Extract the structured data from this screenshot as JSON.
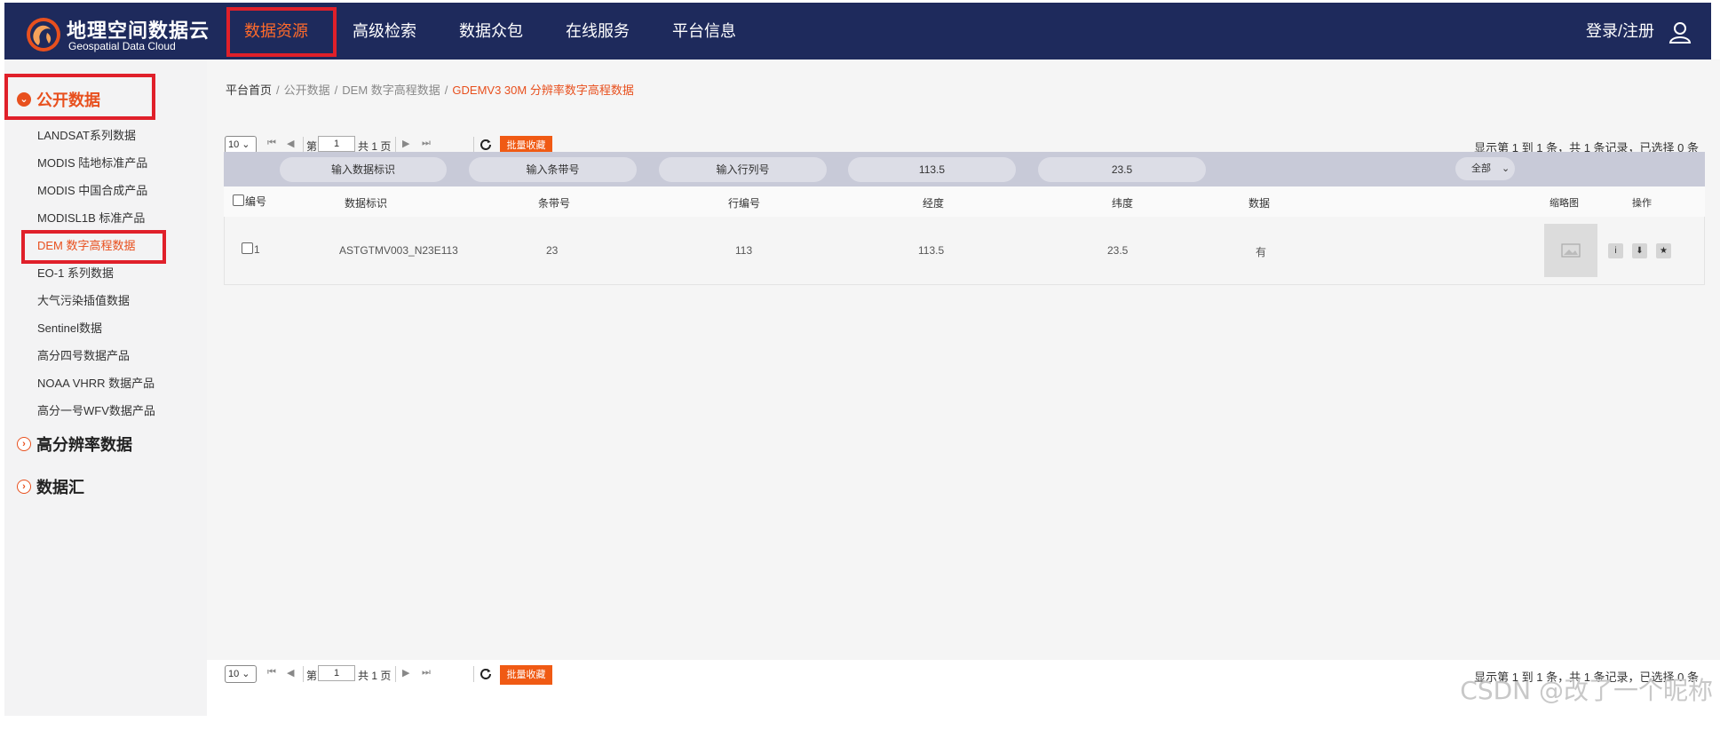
{
  "header": {
    "logo_title": "地理空间数据云",
    "logo_subtitle": "Geospatial Data Cloud",
    "nav": [
      {
        "label": "数据资源",
        "active": true
      },
      {
        "label": "高级检索"
      },
      {
        "label": "数据众包"
      },
      {
        "label": "在线服务"
      },
      {
        "label": "平台信息"
      }
    ],
    "login": "登录/注册",
    "bg_color": "#1e2a5c",
    "accent_color": "#ff6a2a"
  },
  "sidebar": {
    "sections": [
      {
        "label": "公开数据",
        "expanded": true,
        "icon": "chevron-down-icon"
      },
      {
        "label": "高分辨率数据",
        "expanded": false,
        "icon": "chevron-right-icon"
      },
      {
        "label": "数据汇",
        "expanded": false,
        "icon": "chevron-right-icon"
      }
    ],
    "items": [
      {
        "label": "LANDSAT系列数据"
      },
      {
        "label": "MODIS 陆地标准产品"
      },
      {
        "label": "MODIS 中国合成产品"
      },
      {
        "label": "MODISL1B 标准产品"
      },
      {
        "label": "DEM 数字高程数据",
        "active": true
      },
      {
        "label": "EO-1 系列数据"
      },
      {
        "label": "大气污染插值数据"
      },
      {
        "label": "Sentinel数据"
      },
      {
        "label": "高分四号数据产品"
      },
      {
        "label": "NOAA VHRR 数据产品"
      },
      {
        "label": "高分一号WFV数据产品"
      }
    ]
  },
  "breadcrumb": {
    "home": "平台首页",
    "level1": "公开数据",
    "level2": "DEM 数字高程数据",
    "current": "GDEMV3 30M 分辨率数字高程数据",
    "separator": "/"
  },
  "pager": {
    "page_size": "10",
    "page_prefix": "第",
    "page_value": "1",
    "page_suffix": "共 1 页",
    "batch_label": "批量收藏",
    "summary": "显示第 1 到 1 条，共 1 条记录，已选择 0 条"
  },
  "filters": {
    "data_id_placeholder": "输入数据标识",
    "strip_placeholder": "输入条带号",
    "row_placeholder": "输入行列号",
    "longitude": "113.5",
    "latitude": "23.5",
    "data_select": "全部"
  },
  "table": {
    "headers": {
      "no": "编号",
      "data_id": "数据标识",
      "strip": "条带号",
      "row": "行编号",
      "lon": "经度",
      "lat": "纬度",
      "data": "数据",
      "thumb": "缩略图",
      "ops": "操作"
    },
    "rows": [
      {
        "no": "1",
        "data_id": "ASTGTMV003_N23E113",
        "strip": "23",
        "row": "113",
        "lon": "113.5",
        "lat": "23.5",
        "data": "有",
        "ops": [
          "i",
          "⬇",
          "★"
        ]
      }
    ]
  },
  "watermark": "CSDN @改了一个昵称"
}
